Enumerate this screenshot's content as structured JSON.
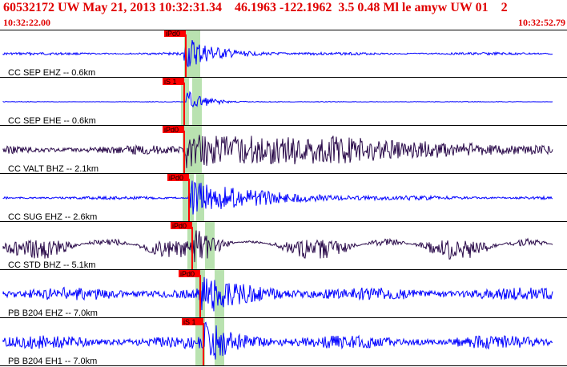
{
  "header": {
    "title": "60532172 UW May 21, 2013 10:32:31.34    46.1963 -122.1962  3.5 0.48 Ml le amyw UW 01    2",
    "time_start": "10:32:22.00",
    "time_end": "10:32:52.79"
  },
  "colors": {
    "trace_blue": "#0000ff",
    "trace_dark": "#2a0a4a",
    "pick_red": "#ff0000",
    "window_green": "#b9e2b0",
    "title_red": "#e00000"
  },
  "traces": [
    {
      "label": "CC SEP EHZ -- 0.6km",
      "pick": "iPd0",
      "color": "blue"
    },
    {
      "label": "CC SEP EHE -- 0.6km",
      "pick": "iS 1",
      "color": "blue"
    },
    {
      "label": "CC VALT BHZ -- 2.1km",
      "pick": "iPd0",
      "color": "dark"
    },
    {
      "label": "CC SUG EHZ -- 2.6km",
      "pick": "iPd0",
      "color": "blue"
    },
    {
      "label": "CC STD BHZ -- 5.1km",
      "pick": "iPd0",
      "color": "dark"
    },
    {
      "label": "PB B204 EHZ -- 7.0km",
      "pick": "iPd0",
      "color": "blue"
    },
    {
      "label": "PB B204 EH1 -- 7.0km",
      "pick": "iS 1",
      "color": "blue"
    }
  ]
}
